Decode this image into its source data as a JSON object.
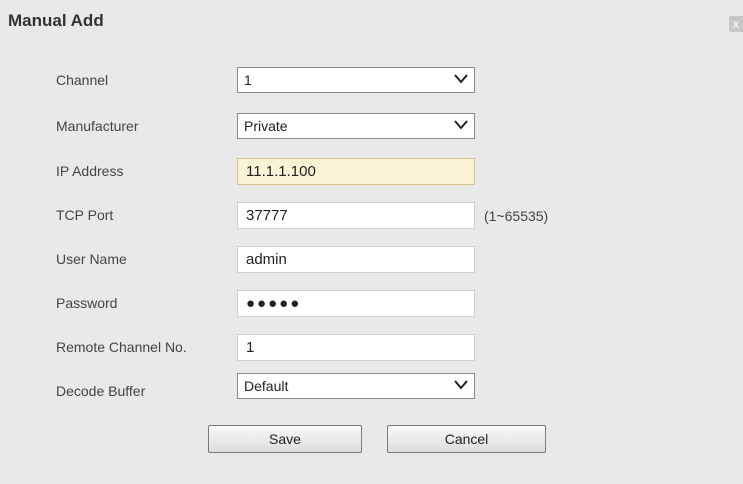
{
  "dialog": {
    "title": "Manual Add",
    "close_glyph": "x"
  },
  "form": {
    "channel": {
      "label": "Channel",
      "value": "1"
    },
    "manufacturer": {
      "label": "Manufacturer",
      "value": "Private"
    },
    "ip_address": {
      "label": "IP Address",
      "value": "11.1.1.100"
    },
    "tcp_port": {
      "label": "TCP Port",
      "value": "37777",
      "hint": "(1~65535)"
    },
    "user_name": {
      "label": "User Name",
      "value": "admin"
    },
    "password": {
      "label": "Password",
      "value": "●●●●●"
    },
    "remote_channel": {
      "label": "Remote Channel No.",
      "value": "1"
    },
    "decode_buffer": {
      "label": "Decode Buffer",
      "value": "Default"
    }
  },
  "buttons": {
    "save": "Save",
    "cancel": "Cancel"
  },
  "colors": {
    "background": "#e9e9e9",
    "highlight_field": "#fbf3d6"
  },
  "icons": {
    "close": "close-icon",
    "dropdown": "chevron-down-icon"
  }
}
